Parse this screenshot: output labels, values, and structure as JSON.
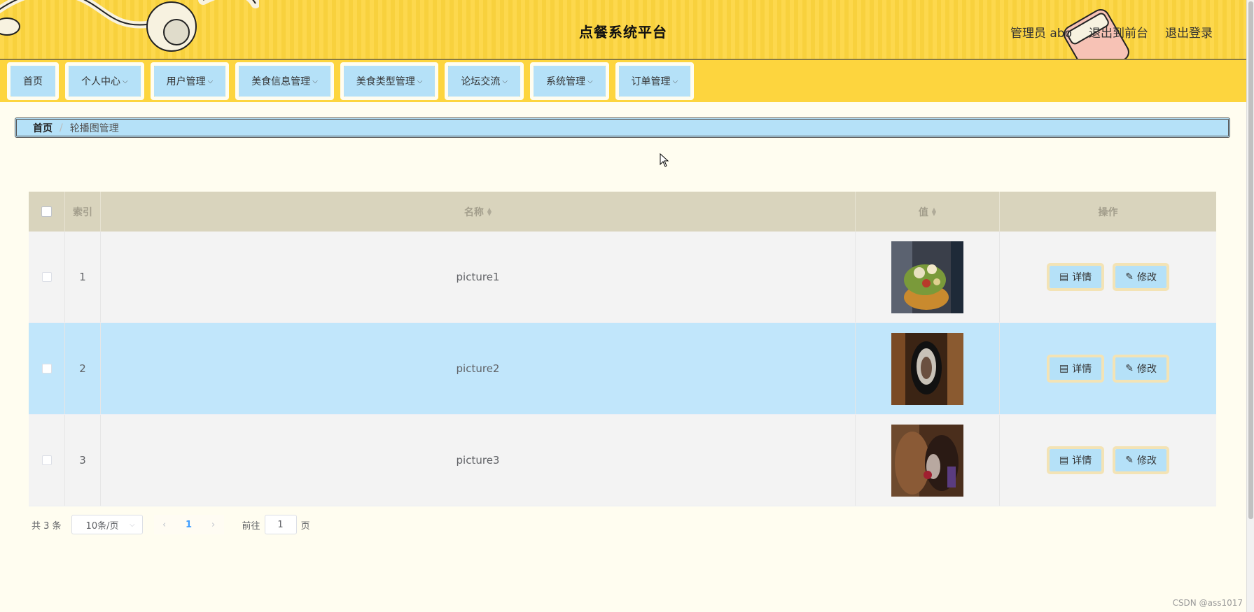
{
  "header": {
    "title": "点餐系统平台",
    "user_label": "管理员 abo",
    "to_front_label": "退出到前台",
    "logout_label": "退出登录"
  },
  "nav": {
    "items": [
      {
        "label": "首页",
        "dropdown": false
      },
      {
        "label": "个人中心",
        "dropdown": true
      },
      {
        "label": "用户管理",
        "dropdown": true
      },
      {
        "label": "美食信息管理",
        "dropdown": true
      },
      {
        "label": "美食类型管理",
        "dropdown": true
      },
      {
        "label": "论坛交流",
        "dropdown": true
      },
      {
        "label": "系统管理",
        "dropdown": true
      },
      {
        "label": "订单管理",
        "dropdown": true
      }
    ]
  },
  "breadcrumb": {
    "home": "首页",
    "separator": "/",
    "current": "轮播图管理"
  },
  "table": {
    "columns": {
      "index": "索引",
      "name": "名称",
      "value": "值",
      "actions": "操作"
    },
    "rows": [
      {
        "index": "1",
        "name": "picture1",
        "image": "food-photo-1"
      },
      {
        "index": "2",
        "name": "picture2",
        "image": "food-photo-2"
      },
      {
        "index": "3",
        "name": "picture3",
        "image": "food-photo-3"
      }
    ],
    "detail_label": "详情",
    "edit_label": "修改"
  },
  "pagination": {
    "total_text": "共 3 条",
    "page_size": "10条/页",
    "current_page": "1",
    "goto_prefix": "前往",
    "goto_value": "1",
    "goto_suffix": "页"
  },
  "watermark": "CSDN @ass1017",
  "colors": {
    "header_bg": "#fdd53e",
    "nav_item_bg": "#b5e1f8",
    "page_bg": "#fffdf0",
    "table_head_bg": "#d9d4bd",
    "row_highlight": "#c1e6fb"
  }
}
